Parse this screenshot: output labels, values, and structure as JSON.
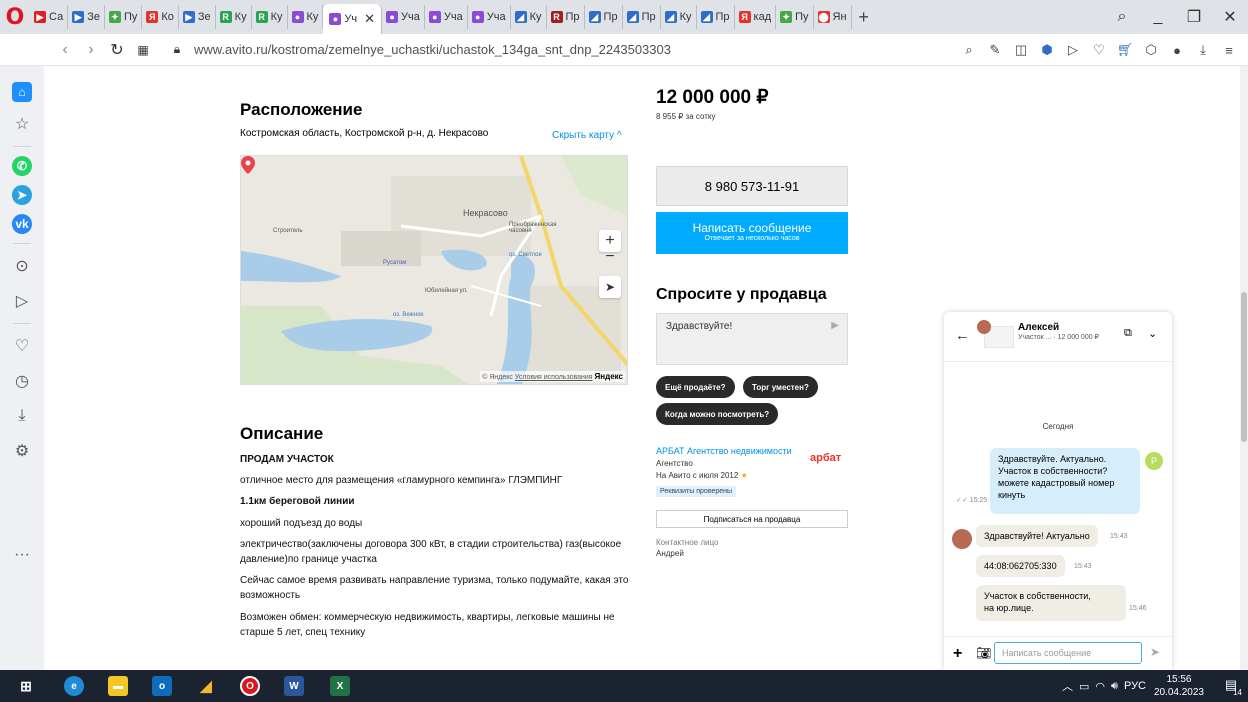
{
  "browser": {
    "tabs": [
      {
        "label": "Са",
        "fav_color": "#e02020",
        "fav_glyph": "▶"
      },
      {
        "label": "Зе",
        "fav_color": "#2f6ec8",
        "fav_glyph": "▶"
      },
      {
        "label": "Пу",
        "fav_color": "#47a847",
        "fav_glyph": "✦"
      },
      {
        "label": "Ко",
        "fav_color": "#e5332a",
        "fav_glyph": "Я"
      },
      {
        "label": "Зе",
        "fav_color": "#2f6ec8",
        "fav_glyph": "▶"
      },
      {
        "label": "Ку",
        "fav_color": "#2aa44f",
        "fav_glyph": "R"
      },
      {
        "label": "Ку",
        "fav_color": "#2aa44f",
        "fav_glyph": "R"
      },
      {
        "label": "Ку",
        "fav_color": "#8c4bd6",
        "fav_glyph": "●"
      }
    ],
    "active_tab": {
      "label": "Уч",
      "fav_color": "#8c4bd6"
    },
    "tabs_after": [
      {
        "label": "Уча",
        "fav_color": "#8c4bd6",
        "fav_glyph": "●"
      },
      {
        "label": "Уча",
        "fav_color": "#8c4bd6",
        "fav_glyph": "●"
      },
      {
        "label": "Уча",
        "fav_color": "#8c4bd6",
        "fav_glyph": "●"
      },
      {
        "label": "Ку",
        "fav_color": "#2f6ec8",
        "fav_glyph": "◢"
      },
      {
        "label": "Пр",
        "fav_color": "#a02020",
        "fav_glyph": "R"
      },
      {
        "label": "Пр",
        "fav_color": "#2f6ec8",
        "fav_glyph": "◢"
      },
      {
        "label": "Пр",
        "fav_color": "#2f6ec8",
        "fav_glyph": "◢"
      },
      {
        "label": "Ку",
        "fav_color": "#2f6ec8",
        "fav_glyph": "◢"
      },
      {
        "label": "Пр",
        "fav_color": "#2f6ec8",
        "fav_glyph": "◢"
      },
      {
        "label": "кад",
        "fav_color": "#e5332a",
        "fav_glyph": "Я"
      },
      {
        "label": "Пу",
        "fav_color": "#47a847",
        "fav_glyph": "✦"
      },
      {
        "label": "Ян",
        "fav_color": "#e5332a",
        "fav_glyph": "⬤"
      }
    ],
    "url": "www.avito.ru/kostroma/zemelnye_uchastki/uchastok_134ga_snt_dnp_2243503303"
  },
  "listing": {
    "location_title": "Расположение",
    "address": "Костромская область, Костромской р-н, д. Некрасово",
    "hide_map": "Скрыть карту ^",
    "map": {
      "labels": [
        "Некрасово",
        "Преображенская часовня",
        "оз. Светлое",
        "Русатом",
        "Строитель",
        "оз. Вежное",
        "Юбилейная ул."
      ],
      "footer_text": "© Яндекс",
      "footer_link": "Условия использования",
      "footer_brand": "Яндекс"
    },
    "description_title": "Описание",
    "description_lines": [
      "ПРОДАМ УЧАСТОК",
      "отличное место для размещения «гламурного кемпинга» ГЛЭМПИНГ",
      "1.1км береговой линии",
      "хороший подъезд до воды",
      "электричество(заключены договора 300 кВт, в стадии строительства) газ(высокое давление)по границе участка",
      "Сейчас самое время развивать направление туризма, только подумайте, какая это возможность",
      "Возможен обмен: коммерческую недвижимость, квартиры, легковые машины не старше 5 лет, спец технику"
    ]
  },
  "price": {
    "value": "12 000 000 ₽",
    "per_unit": "8 955 ₽ за сотку",
    "phone": "8 980 573-11-91",
    "message_button": "Написать сообщение",
    "message_sub": "Отвечает за несколько часов"
  },
  "ask": {
    "title": "Спросите у продавца",
    "input_value": "Здравствуйте!",
    "quick_replies": [
      "Ещё продаёте?",
      "Торг уместен?",
      "Когда можно посмотреть?"
    ]
  },
  "seller": {
    "name": "АРБАТ Агентство недвижимости",
    "type": "Агентство",
    "since": "На Авито с июля 2012",
    "badge": "Реквизиты проверены",
    "logo": "арбат",
    "subscribe": "Подписаться на продавца",
    "contact_label": "Контактное лицо",
    "contact_name": "Андрей"
  },
  "chat": {
    "name": "Алексей",
    "subtitle": "Участок ... · 12 000 000 ₽",
    "day": "Сегодня",
    "messages": [
      {
        "from": "me",
        "text": "Здравствуйте. Актуально. Участок в собственности? можете кадастровый номер кинуть",
        "time": "15:25"
      },
      {
        "from": "them",
        "text": "Здравствуйте! Актуально",
        "time": "15:43"
      },
      {
        "from": "them",
        "text": "44:08:062705:330",
        "time": "15:43"
      },
      {
        "from": "them",
        "text": "Участок в собственности, на юр.лице.",
        "time": "15:46"
      }
    ],
    "my_avatar_letter": "Р",
    "input_placeholder": "Написать сообщение"
  },
  "taskbar": {
    "lang": "РУС",
    "time": "15:56",
    "date": "20.04.2023",
    "notif_count": "14"
  },
  "colors": {
    "avito_blue": "#00aaff",
    "link_blue": "#0091e6",
    "opera_red": "#e0141f"
  }
}
